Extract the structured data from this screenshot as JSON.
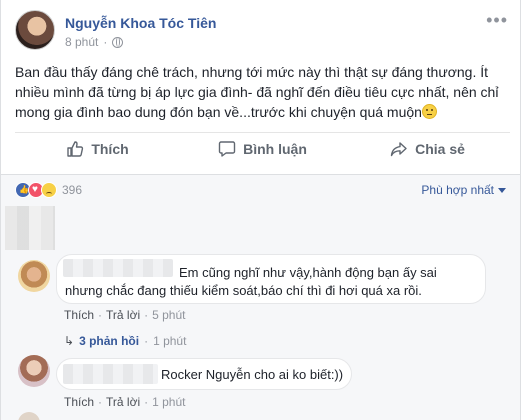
{
  "post": {
    "author": "Nguyễn Khoa Tóc Tiên",
    "time": "8 phút",
    "more": "•••",
    "text": "Ban đầu thấy đáng chê trách, nhưng tới mức này thì thật sự đáng thương. Ít nhiều mình đã từng bị áp lực gia đình- đã nghĩ đến điều tiêu cực nhất, nên chỉ mong gia đình bao dung đón bạn về...trước khi chuyện quá muộn"
  },
  "actions": {
    "like": "Thích",
    "comment": "Bình luận",
    "share": "Chia sẻ"
  },
  "reactions": {
    "count": "396",
    "sort_label": "Phù hợp nhất"
  },
  "comments": [
    {
      "text_line1": "Em cũng nghĩ như vậy,hành động bạn ấy sai",
      "text_line2": "nhưng chắc đang thiếu kiểm soát,báo chí thì đi hơi quá xa rồi.",
      "like": "Thích",
      "sep": "·",
      "reply": "Trả lời",
      "time": "5 phút",
      "replies_label": "3 phản hồi",
      "replies_time": "1 phút"
    },
    {
      "text": "Rocker Nguyễn cho ai ko biết:))",
      "like": "Thích",
      "sep": "·",
      "reply": "Trả lời",
      "time": "1 phút"
    }
  ],
  "colors": {
    "link": "#365899",
    "secondary": "#90949c",
    "background": "#e9ebee"
  }
}
